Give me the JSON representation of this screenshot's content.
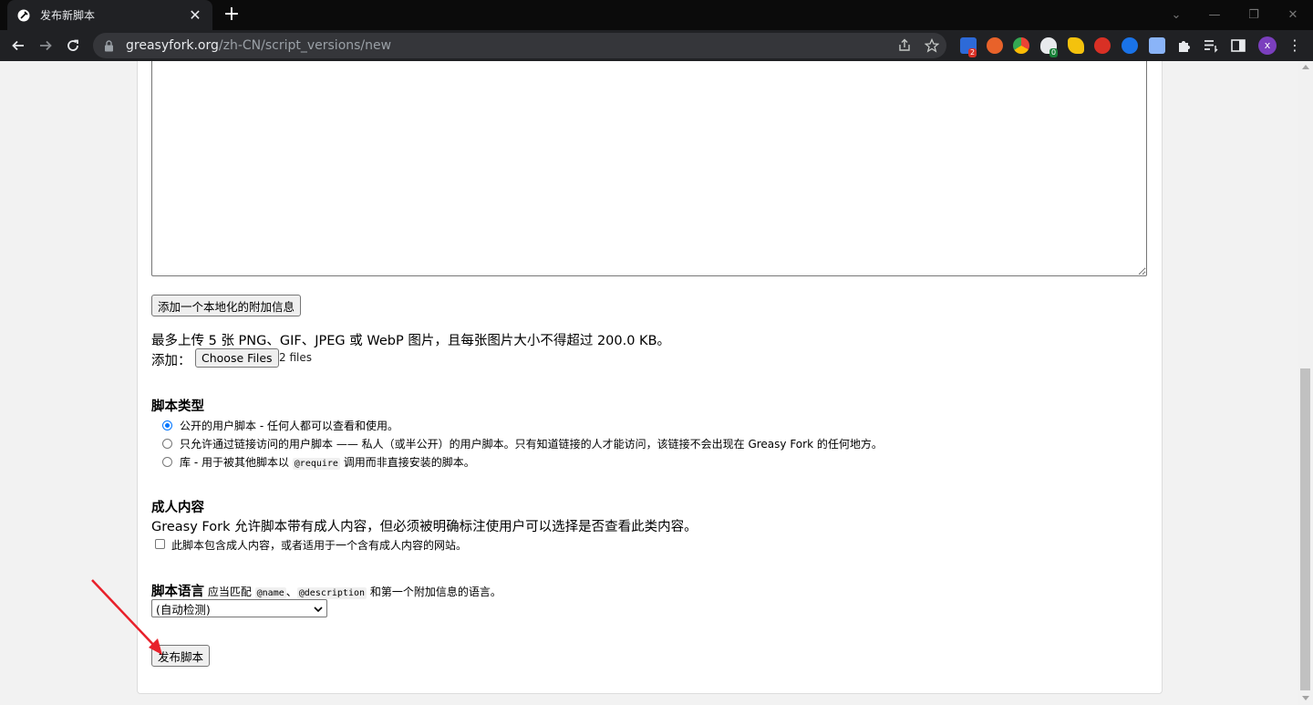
{
  "browser": {
    "tab_title": "发布新脚本",
    "url_host": "greasyfork.org",
    "url_path": "/zh-CN/script_versions/new",
    "ext_badges": [
      "2",
      "0"
    ],
    "profile_initial": "x"
  },
  "form": {
    "add_localized_button": "添加一个本地化的附加信息",
    "upload_note": "最多上传 5 张 PNG、GIF、JPEG 或 WebP 图片，且每张图片大小不得超过 200.0 KB。",
    "add_label": "添加：",
    "choose_files_button": "Choose Files",
    "files_status": "2 files",
    "script_type": {
      "heading": "脚本类型",
      "options": [
        {
          "label": "公开的用户脚本 - 任何人都可以查看和使用。",
          "selected": true
        },
        {
          "label": "只允许通过链接访问的用户脚本 —— 私人（或半公开）的用户脚本。只有知道链接的人才能访问，该链接不会出现在 Greasy Fork 的任何地方。",
          "selected": false
        },
        {
          "label_pre": "库 - 用于被其他脚本以 ",
          "label_code": "@require",
          "label_post": " 调用而非直接安装的脚本。",
          "selected": false
        }
      ]
    },
    "adult": {
      "heading": "成人内容",
      "description": "Greasy Fork 允许脚本带有成人内容，但必须被明确标注使用户可以选择是否查看此类内容。",
      "checkbox_label": "此脚本包含成人内容，或者适用于一个含有成人内容的网站。"
    },
    "language": {
      "heading": "脚本语言",
      "note_pre": " 应当匹配 ",
      "code1": "@name",
      "sep": "、",
      "code2": "@description",
      "note_post": " 和第一个附加信息的语言。",
      "selected": "(自动检测)"
    },
    "publish_button": "发布脚本"
  },
  "colors": {
    "accent": "#0075ff",
    "annotation_arrow": "#e8212b"
  }
}
